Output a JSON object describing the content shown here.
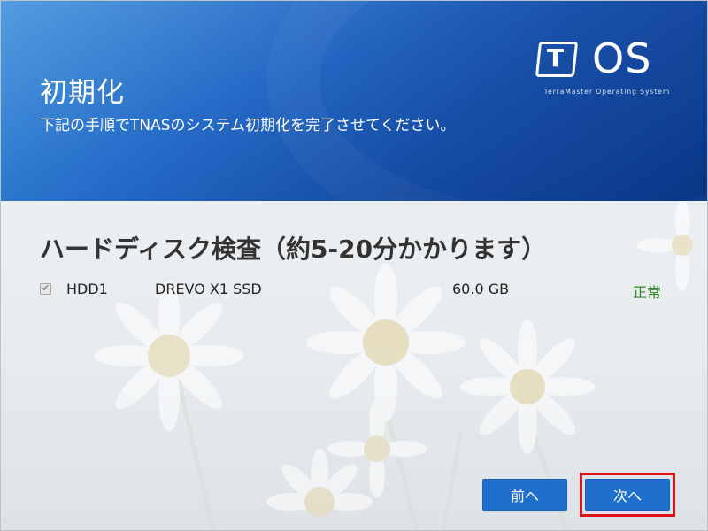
{
  "header": {
    "title": "初期化",
    "subtitle": "下記の手順でTNASのシステム初期化を完了させてください。"
  },
  "logo": {
    "mark": "T",
    "text": "OS",
    "tagline": "TerraMaster Operating System"
  },
  "main": {
    "section_title": "ハードディスク検査（約5-20分かかります）",
    "disks": [
      {
        "checked": true,
        "name": "HDD1",
        "model": "DREVO X1 SSD",
        "size": "60.0 GB",
        "status": "正常"
      }
    ]
  },
  "buttons": {
    "prev_label": "前へ",
    "next_label": "次へ"
  },
  "colors": {
    "header_blue": "#1a63c4",
    "button_blue": "#1f6fcf",
    "status_green": "#2f8a1f",
    "highlight_red": "#e0101a"
  }
}
